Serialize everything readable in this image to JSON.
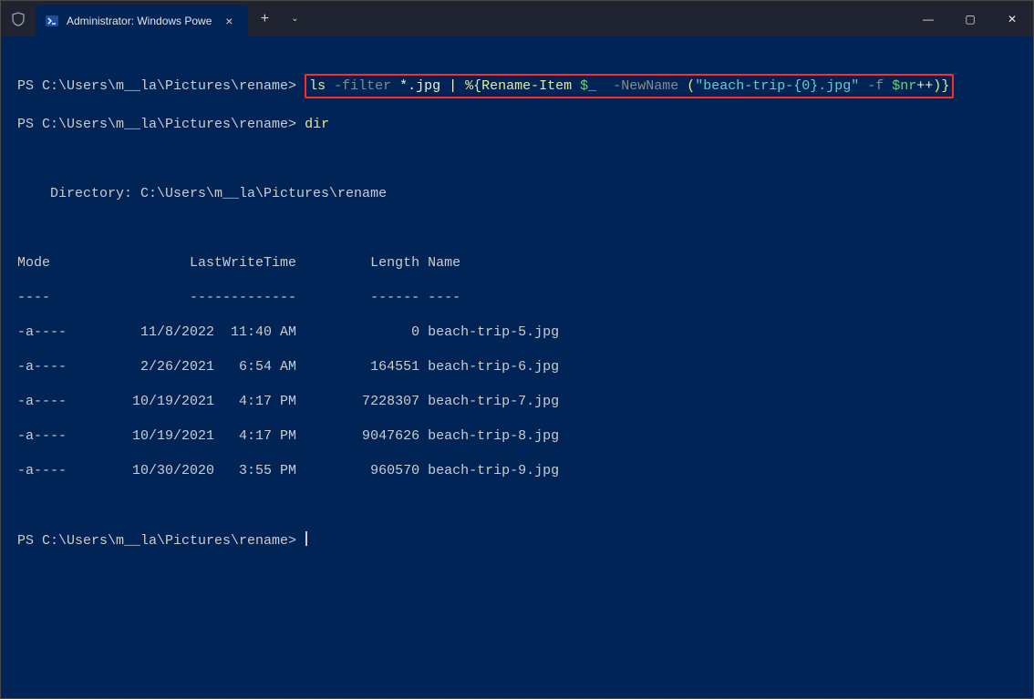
{
  "titlebar": {
    "tab_title": "Administrator: Windows Powe",
    "tab_icon_name": "powershell-icon",
    "shield_icon_name": "shield-icon",
    "close_tab_glyph": "×",
    "new_tab_glyph": "+",
    "dropdown_glyph": "⌄",
    "min_glyph": "—",
    "max_glyph": "▢",
    "close_glyph": "✕"
  },
  "term": {
    "prompt1": "PS C:\\Users\\m__la\\Pictures\\rename> ",
    "cmd1": {
      "seg1": "ls ",
      "seg2": "-filter ",
      "seg3": "*.jpg ",
      "seg4": "| ",
      "seg5": "%{",
      "seg6": "Rename-Item ",
      "seg7": "$_ ",
      "seg8": " -NewName ",
      "seg9": "(",
      "seg10": "\"beach-trip-{0}.jpg\"",
      "seg11": " -f ",
      "seg12": "$nr",
      "seg13": "++",
      "seg14": ")",
      "seg15": "}"
    },
    "prompt2": "PS C:\\Users\\m__la\\Pictures\\rename> ",
    "cmd2": "dir",
    "blank": "",
    "dir_header": "    Directory: C:\\Users\\m__la\\Pictures\\rename",
    "table_header": "Mode                 LastWriteTime         Length Name",
    "table_rule": "----                 -------------         ------ ----",
    "rows": {
      "r0": "-a----         11/8/2022  11:40 AM              0 beach-trip-5.jpg",
      "r1": "-a----         2/26/2021   6:54 AM         164551 beach-trip-6.jpg",
      "r2": "-a----        10/19/2021   4:17 PM        7228307 beach-trip-7.jpg",
      "r3": "-a----        10/19/2021   4:17 PM        9047626 beach-trip-8.jpg",
      "r4": "-a----        10/30/2020   3:55 PM         960570 beach-trip-9.jpg"
    },
    "prompt3": "PS C:\\Users\\m__la\\Pictures\\rename> "
  },
  "highlight_color": "#ff2a2a"
}
